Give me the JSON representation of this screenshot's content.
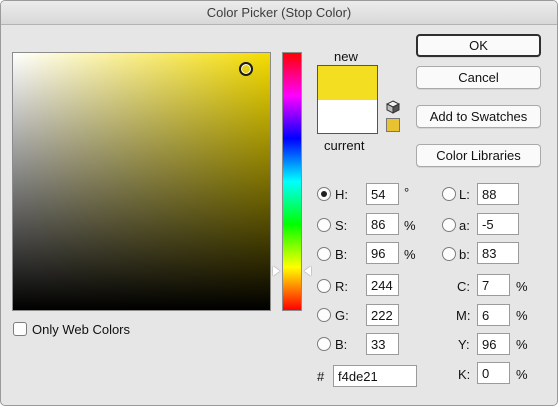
{
  "window": {
    "title": "Color Picker (Stop Color)"
  },
  "swatches": {
    "new_label": "new",
    "current_label": "current",
    "new_color": "#f4de21",
    "current_color": "#ffffff"
  },
  "buttons": {
    "ok": "OK",
    "cancel": "Cancel",
    "add_to_swatches": "Add to Swatches",
    "color_libraries": "Color Libraries"
  },
  "hsb": {
    "h_label": "H:",
    "h_value": "54",
    "h_unit": "°",
    "s_label": "S:",
    "s_value": "86",
    "s_unit": "%",
    "b_label": "B:",
    "b_value": "96",
    "b_unit": "%"
  },
  "rgb": {
    "r_label": "R:",
    "r_value": "244",
    "g_label": "G:",
    "g_value": "222",
    "b_label": "B:",
    "b_value": "33"
  },
  "lab": {
    "l_label": "L:",
    "l_value": "88",
    "a_label": "a:",
    "a_value": "-5",
    "b_label": "b:",
    "b_value": "83"
  },
  "cmyk": {
    "c_label": "C:",
    "c_value": "7",
    "c_unit": "%",
    "m_label": "M:",
    "m_value": "6",
    "m_unit": "%",
    "y_label": "Y:",
    "y_value": "96",
    "y_unit": "%",
    "k_label": "K:",
    "k_value": "0",
    "k_unit": "%"
  },
  "hex": {
    "label": "#",
    "value": "f4de21"
  },
  "web_colors": {
    "label": "Only Web Colors",
    "checked": false
  },
  "selected_mode": "H",
  "colors": {
    "field_hue": "#f5dc00",
    "gamut_swatch": "#e8c230"
  }
}
